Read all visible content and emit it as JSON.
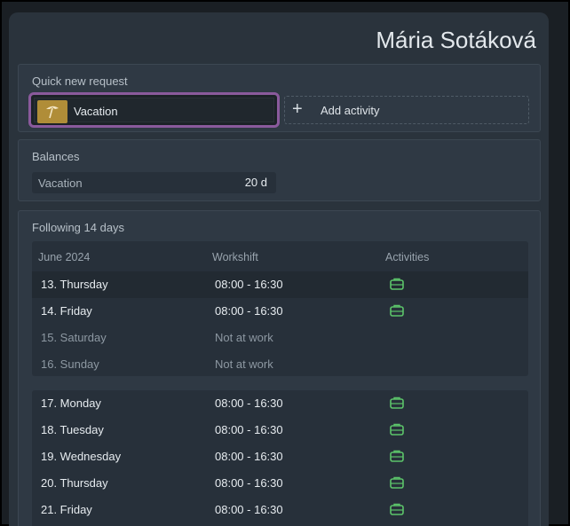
{
  "user": {
    "name": "Mária Sotáková"
  },
  "quick_request": {
    "title": "Quick new request",
    "vacation_label": "Vacation",
    "add_activity_plus": "+",
    "add_activity_label": "Add activity"
  },
  "balances": {
    "title": "Balances",
    "items": [
      {
        "name": "Vacation",
        "value": "20 d"
      }
    ]
  },
  "following": {
    "title": "Following 14 days",
    "columns": {
      "month": "June 2024",
      "workshift": "Workshift",
      "activities": "Activities"
    },
    "week1": [
      {
        "day": "13. Thursday",
        "shift": "08:00 - 16:30",
        "activity": "briefcase-icon"
      },
      {
        "day": "14. Friday",
        "shift": "08:00 - 16:30",
        "activity": "briefcase-icon"
      },
      {
        "day": "15. Saturday",
        "shift": "Not at work",
        "activity": ""
      },
      {
        "day": "16. Sunday",
        "shift": "Not at work",
        "activity": ""
      }
    ],
    "week2": [
      {
        "day": "17. Monday",
        "shift": "08:00 - 16:30",
        "activity": "briefcase-icon"
      },
      {
        "day": "18. Tuesday",
        "shift": "08:00 - 16:30",
        "activity": "briefcase-icon"
      },
      {
        "day": "19. Wednesday",
        "shift": "08:00 - 16:30",
        "activity": "briefcase-icon"
      },
      {
        "day": "20. Thursday",
        "shift": "08:00 - 16:30",
        "activity": "briefcase-icon"
      },
      {
        "day": "21. Friday",
        "shift": "08:00 - 16:30",
        "activity": "briefcase-icon"
      }
    ]
  },
  "colors": {
    "accent_highlight": "#8a5a9c",
    "vacation_icon_bg": "#b08d38",
    "activity_icon": "#5cc46a"
  }
}
